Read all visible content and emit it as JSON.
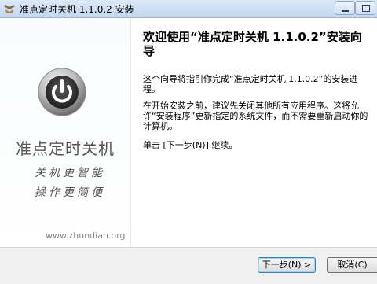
{
  "window": {
    "title": "准点定时关机 1.1.0.2 安装",
    "controls": {
      "minimize_icon": "minimize-icon",
      "maximize_icon": "maximize-icon"
    }
  },
  "banner": {
    "logo_icon": "power-icon",
    "product_name": "准点定时关机",
    "slogan_line1": "关机更智能",
    "slogan_line2": "操作更简便",
    "website": "www.zhundian.org"
  },
  "content": {
    "title": "欢迎使用“准点定时关机 1.1.0.2”安装向导",
    "paragraph1": "这个向导将指引你完成“准点定时关机 1.1.0.2”的安装进程。",
    "paragraph2": "在开始安装之前，建议先关闭其他所有应用程序。这将允许“安装程序”更新指定的系统文件，而不需要重新启动你的计算机。",
    "paragraph3": "单击 [下一步(N)] 继续。"
  },
  "buttons": {
    "next": "下一步(N) >",
    "cancel": "取消(C)"
  },
  "colors": {
    "title_bar": "#c3d7ee",
    "accent_button_border": "#3c7fb1"
  }
}
